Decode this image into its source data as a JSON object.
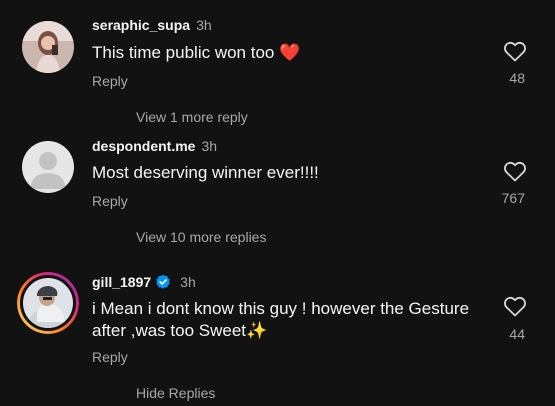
{
  "comments": [
    {
      "username": "seraphic_supa",
      "time": "3h",
      "text": "This time public won too ❤️",
      "reply_label": "Reply",
      "likes": "48",
      "thread_link": "View 1 more reply",
      "avatar_colors": {
        "bg": "#d8c7c0",
        "accent": "#8a5d54"
      }
    },
    {
      "username": "despondent.me",
      "time": "3h",
      "text": "Most deserving winner ever!!!!",
      "reply_label": "Reply",
      "likes": "767",
      "thread_link": "View 10 more replies",
      "avatar_colors": {
        "bg": "#e6e6e6",
        "accent": "#c2c2c2"
      }
    },
    {
      "username": "gill_1897",
      "time": "3h",
      "text": "i Mean i dont know this guy ! however the Gesture after ,was too Sweet✨",
      "reply_label": "Reply",
      "likes": "44",
      "thread_link": "Hide Replies",
      "verified": true,
      "avatar_colors": {
        "bg": "#dfe3e8",
        "accent": "#5b5f66",
        "ring": "#d62976"
      }
    }
  ],
  "icons": {
    "like": "heart-outline-icon",
    "verified": "verified-badge-icon"
  },
  "colors": {
    "background": "#121212",
    "primary_text": "#f5f5f5",
    "secondary_text": "#a8a8a8",
    "verified_blue": "#0095f6"
  }
}
